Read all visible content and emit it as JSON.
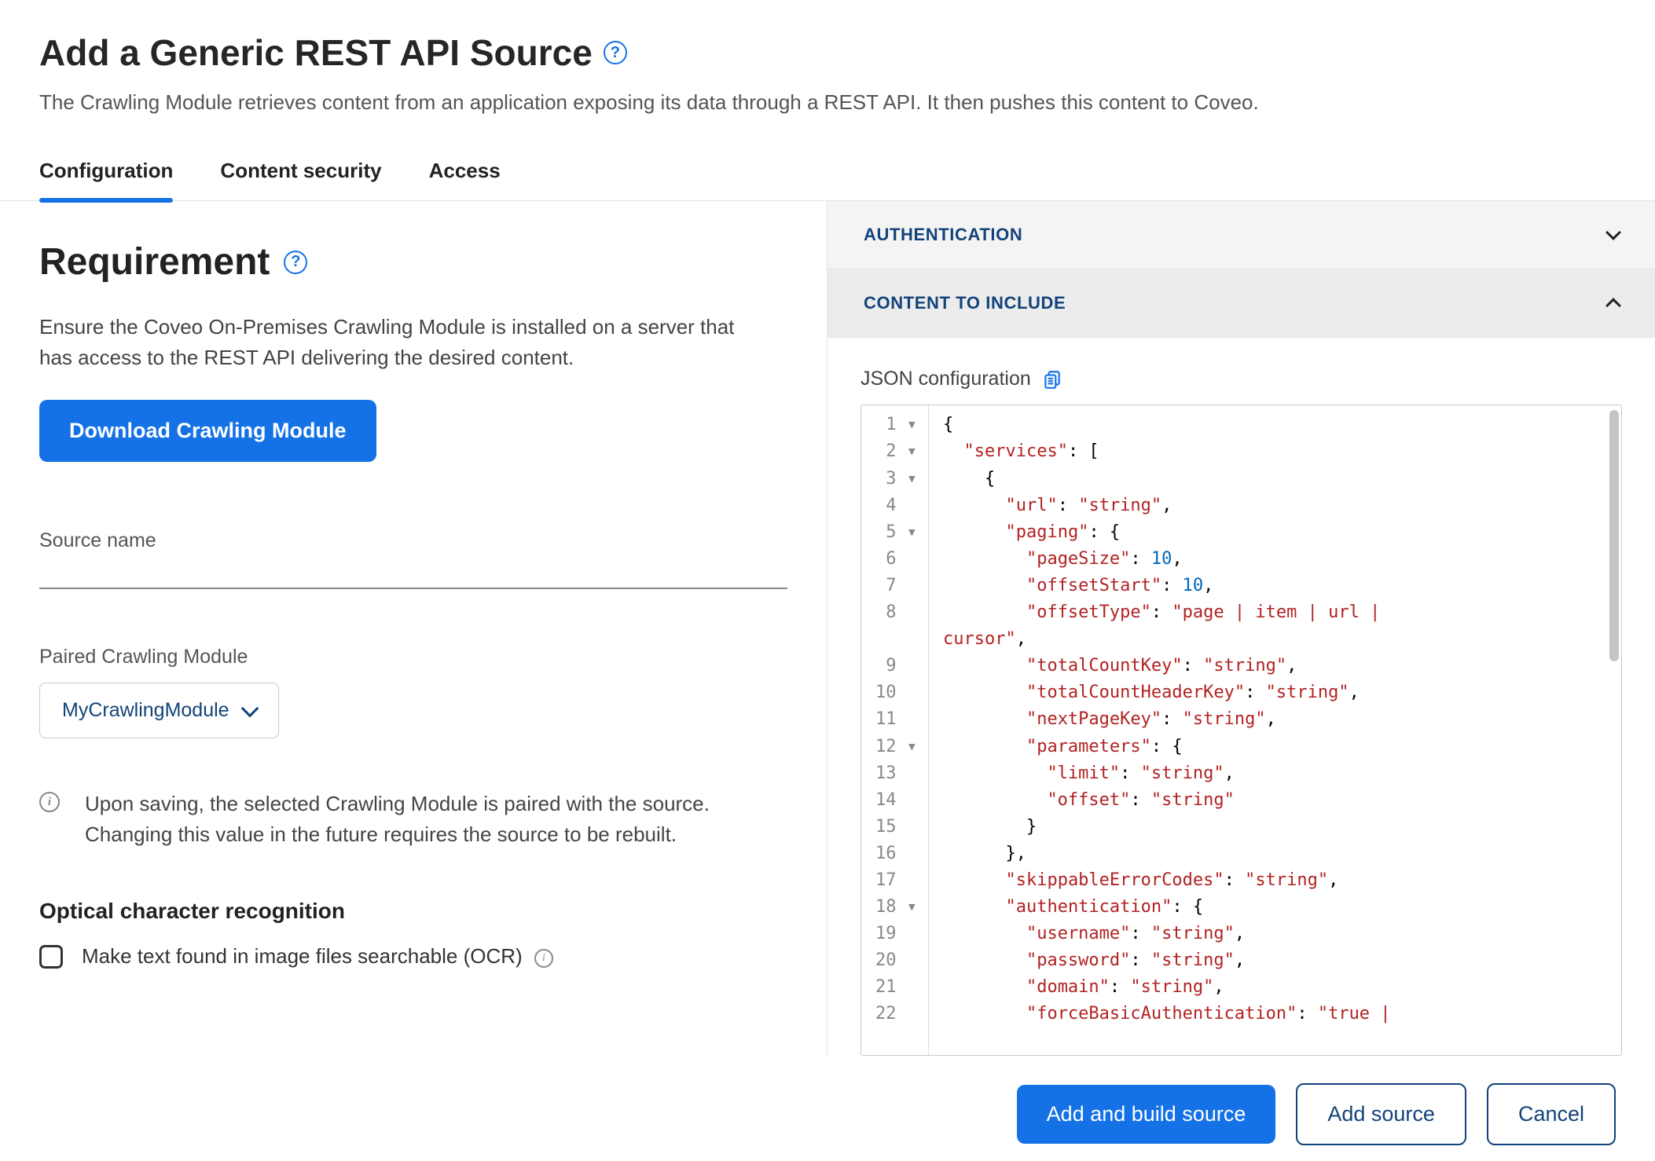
{
  "header": {
    "title": "Add a Generic REST API Source",
    "subtitle": "The Crawling Module retrieves content from an application exposing its data through a REST API. It then pushes this content to Coveo."
  },
  "tabs": [
    {
      "label": "Configuration",
      "active": true
    },
    {
      "label": "Content security",
      "active": false
    },
    {
      "label": "Access",
      "active": false
    }
  ],
  "requirement": {
    "title": "Requirement",
    "text": "Ensure the Coveo On-Premises Crawling Module is installed on a server that has access to the REST API delivering the desired content.",
    "download_label": "Download Crawling Module"
  },
  "source_name": {
    "label": "Source name",
    "value": ""
  },
  "paired": {
    "label": "Paired Crawling Module",
    "selected": "MyCrawlingModule",
    "note": "Upon saving, the selected Crawling Module is paired with the source. Changing this value in the future requires the source to be rebuilt."
  },
  "ocr": {
    "title": "Optical character recognition",
    "checkbox_label": "Make text found in image files searchable (OCR)"
  },
  "accordion": {
    "authentication": "AUTHENTICATION",
    "content_to_include": "CONTENT TO INCLUDE"
  },
  "json_editor": {
    "label": "JSON configuration",
    "gutter": [
      {
        "n": "1",
        "fold": true
      },
      {
        "n": "2",
        "fold": true
      },
      {
        "n": "3",
        "fold": true
      },
      {
        "n": "4",
        "fold": false
      },
      {
        "n": "5",
        "fold": true
      },
      {
        "n": "6",
        "fold": false
      },
      {
        "n": "7",
        "fold": false
      },
      {
        "n": "8",
        "fold": false
      },
      {
        "n": "",
        "fold": false
      },
      {
        "n": "9",
        "fold": false
      },
      {
        "n": "10",
        "fold": false
      },
      {
        "n": "11",
        "fold": false
      },
      {
        "n": "12",
        "fold": true
      },
      {
        "n": "13",
        "fold": false
      },
      {
        "n": "14",
        "fold": false
      },
      {
        "n": "15",
        "fold": false
      },
      {
        "n": "16",
        "fold": false
      },
      {
        "n": "17",
        "fold": false
      },
      {
        "n": "18",
        "fold": true
      },
      {
        "n": "19",
        "fold": false
      },
      {
        "n": "20",
        "fold": false
      },
      {
        "n": "21",
        "fold": false
      },
      {
        "n": "22",
        "fold": false
      }
    ],
    "lines": [
      [
        [
          "p",
          "{"
        ]
      ],
      [
        [
          "p",
          "  "
        ],
        [
          "k",
          "\"services\""
        ],
        [
          "p",
          ": ["
        ]
      ],
      [
        [
          "p",
          "    {"
        ]
      ],
      [
        [
          "p",
          "      "
        ],
        [
          "k",
          "\"url\""
        ],
        [
          "p",
          ": "
        ],
        [
          "k",
          "\"string\""
        ],
        [
          "p",
          ","
        ]
      ],
      [
        [
          "p",
          "      "
        ],
        [
          "k",
          "\"paging\""
        ],
        [
          "p",
          ": {"
        ]
      ],
      [
        [
          "p",
          "        "
        ],
        [
          "k",
          "\"pageSize\""
        ],
        [
          "p",
          ": "
        ],
        [
          "num",
          "10"
        ],
        [
          "p",
          ","
        ]
      ],
      [
        [
          "p",
          "        "
        ],
        [
          "k",
          "\"offsetStart\""
        ],
        [
          "p",
          ": "
        ],
        [
          "num",
          "10"
        ],
        [
          "p",
          ","
        ]
      ],
      [
        [
          "p",
          "        "
        ],
        [
          "k",
          "\"offsetType\""
        ],
        [
          "p",
          ": "
        ],
        [
          "k",
          "\"page | item | url | "
        ]
      ],
      [
        [
          "k",
          "cursor\""
        ],
        [
          "p",
          ","
        ]
      ],
      [
        [
          "p",
          "        "
        ],
        [
          "k",
          "\"totalCountKey\""
        ],
        [
          "p",
          ": "
        ],
        [
          "k",
          "\"string\""
        ],
        [
          "p",
          ","
        ]
      ],
      [
        [
          "p",
          "        "
        ],
        [
          "k",
          "\"totalCountHeaderKey\""
        ],
        [
          "p",
          ": "
        ],
        [
          "k",
          "\"string\""
        ],
        [
          "p",
          ","
        ]
      ],
      [
        [
          "p",
          "        "
        ],
        [
          "k",
          "\"nextPageKey\""
        ],
        [
          "p",
          ": "
        ],
        [
          "k",
          "\"string\""
        ],
        [
          "p",
          ","
        ]
      ],
      [
        [
          "p",
          "        "
        ],
        [
          "k",
          "\"parameters\""
        ],
        [
          "p",
          ": {"
        ]
      ],
      [
        [
          "p",
          "          "
        ],
        [
          "k",
          "\"limit\""
        ],
        [
          "p",
          ": "
        ],
        [
          "k",
          "\"string\""
        ],
        [
          "p",
          ","
        ]
      ],
      [
        [
          "p",
          "          "
        ],
        [
          "k",
          "\"offset\""
        ],
        [
          "p",
          ": "
        ],
        [
          "k",
          "\"string\""
        ]
      ],
      [
        [
          "p",
          "        }"
        ]
      ],
      [
        [
          "p",
          "      },"
        ]
      ],
      [
        [
          "p",
          "      "
        ],
        [
          "k",
          "\"skippableErrorCodes\""
        ],
        [
          "p",
          ": "
        ],
        [
          "k",
          "\"string\""
        ],
        [
          "p",
          ","
        ]
      ],
      [
        [
          "p",
          "      "
        ],
        [
          "k",
          "\"authentication\""
        ],
        [
          "p",
          ": {"
        ]
      ],
      [
        [
          "p",
          "        "
        ],
        [
          "k",
          "\"username\""
        ],
        [
          "p",
          ": "
        ],
        [
          "k",
          "\"string\""
        ],
        [
          "p",
          ","
        ]
      ],
      [
        [
          "p",
          "        "
        ],
        [
          "k",
          "\"password\""
        ],
        [
          "p",
          ": "
        ],
        [
          "k",
          "\"string\""
        ],
        [
          "p",
          ","
        ]
      ],
      [
        [
          "p",
          "        "
        ],
        [
          "k",
          "\"domain\""
        ],
        [
          "p",
          ": "
        ],
        [
          "k",
          "\"string\""
        ],
        [
          "p",
          ","
        ]
      ],
      [
        [
          "p",
          "        "
        ],
        [
          "k",
          "\"forceBasicAuthentication\""
        ],
        [
          "p",
          ": "
        ],
        [
          "k",
          "\"true | "
        ]
      ]
    ]
  },
  "footer": {
    "add_build": "Add and build source",
    "add": "Add source",
    "cancel": "Cancel"
  }
}
